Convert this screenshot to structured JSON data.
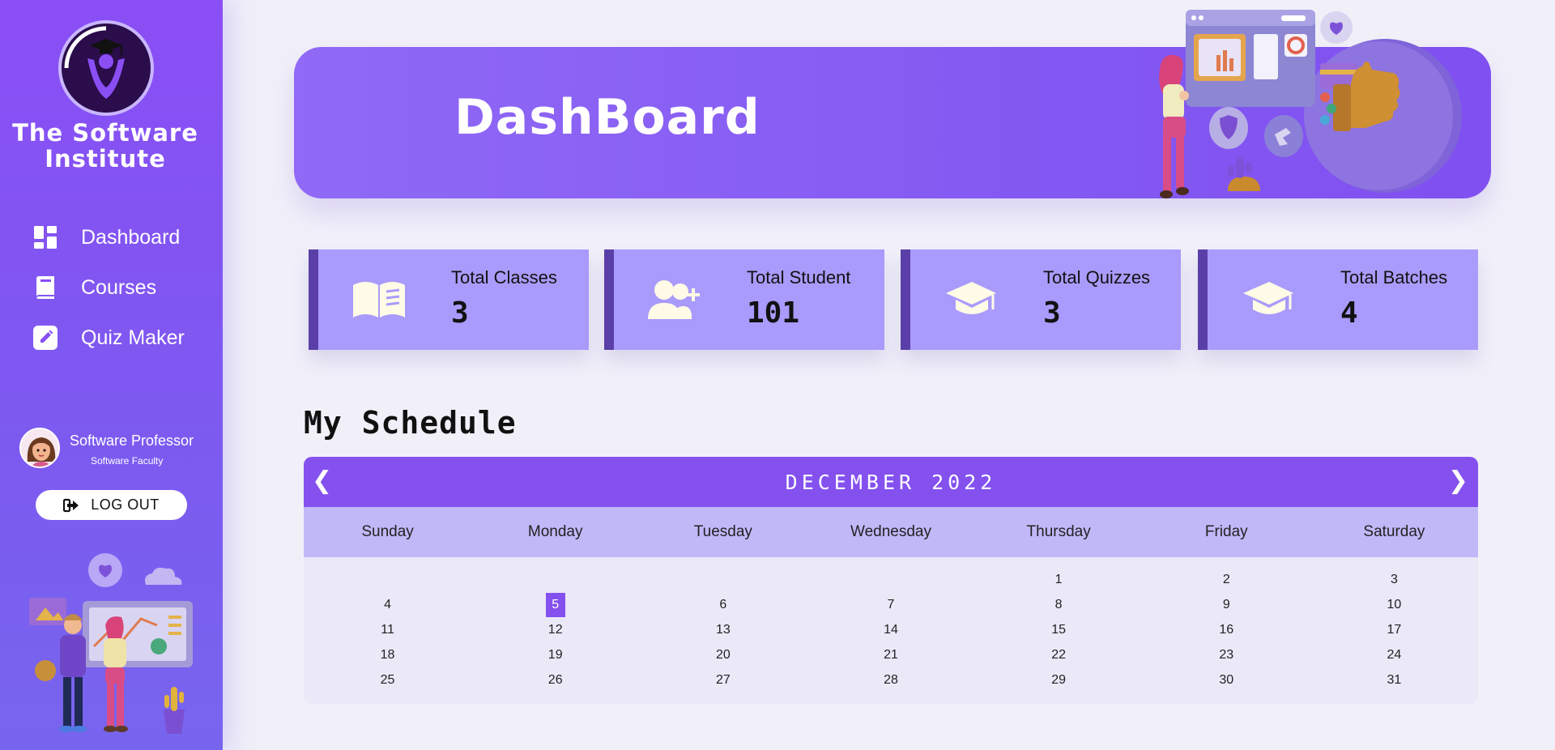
{
  "sidebar": {
    "brand_line1": "The Software",
    "brand_line2": "Institute",
    "items": [
      {
        "label": "Dashboard",
        "icon": "dashboard-grid-icon"
      },
      {
        "label": "Courses",
        "icon": "book-icon"
      },
      {
        "label": "Quiz Maker",
        "icon": "edit-pencil-icon"
      }
    ],
    "profile": {
      "name": "Software Professor",
      "role": "Software Faculty"
    },
    "logout_label": "LOG OUT"
  },
  "banner": {
    "title": "DashBoard"
  },
  "stats": [
    {
      "label": "Total Classes",
      "value": "3",
      "icon": "open-book-icon"
    },
    {
      "label": "Total Student",
      "value": "101",
      "icon": "add-users-icon"
    },
    {
      "label": "Total Quizzes",
      "value": "3",
      "icon": "graduation-cap-icon"
    },
    {
      "label": "Total Batches",
      "value": "4",
      "icon": "graduation-cap-icon"
    }
  ],
  "schedule": {
    "title": "My Schedule",
    "month_label": "DECEMBER 2022",
    "prev_icon": "chevron-left-icon",
    "next_icon": "chevron-right-icon",
    "weekdays": [
      "Sunday",
      "Monday",
      "Tuesday",
      "Wednesday",
      "Thursday",
      "Friday",
      "Saturday"
    ],
    "days": [
      "",
      "",
      "",
      "",
      "1",
      "2",
      "3",
      "4",
      "5",
      "6",
      "7",
      "8",
      "9",
      "10",
      "11",
      "12",
      "13",
      "14",
      "15",
      "16",
      "17",
      "18",
      "19",
      "20",
      "21",
      "22",
      "23",
      "24",
      "25",
      "26",
      "27",
      "28",
      "29",
      "30",
      "31"
    ],
    "today": "5"
  },
  "colors": {
    "accent": "#8451ef",
    "sidebar_top": "#8a4ef5",
    "card_bg": "#a99bfb",
    "card_border": "#5b3fa8",
    "weekday_bar": "#c1b8f8",
    "page_bg": "#f1f0f9"
  }
}
